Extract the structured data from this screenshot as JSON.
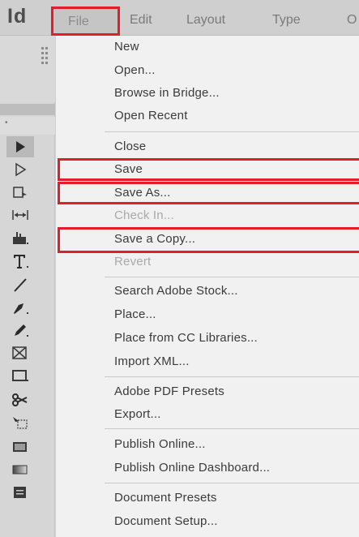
{
  "app": {
    "logo": "Id"
  },
  "menubar": {
    "file": "File",
    "edit": "Edit",
    "layout": "Layout",
    "type": "Type",
    "object_partial": "O"
  },
  "file_menu": {
    "new": "New",
    "open": "Open...",
    "browse_in_bridge": "Browse in Bridge...",
    "open_recent": "Open Recent",
    "close": "Close",
    "save": "Save",
    "save_as": "Save As...",
    "check_in": "Check In...",
    "save_a_copy": "Save a Copy...",
    "revert": "Revert",
    "search_adobe_stock": "Search Adobe Stock...",
    "place": "Place...",
    "place_from_cc_libraries": "Place from CC Libraries...",
    "import_xml": "Import XML...",
    "adobe_pdf_presets": "Adobe PDF Presets",
    "export": "Export...",
    "publish_online": "Publish Online...",
    "publish_online_dashboard": "Publish Online Dashboard...",
    "document_presets": "Document Presets",
    "document_setup": "Document Setup..."
  },
  "tools": [
    "selection-tool",
    "direct-selection-tool",
    "page-tool",
    "gap-tool",
    "content-collector-tool",
    "type-tool",
    "line-tool",
    "pen-tool",
    "pencil-tool",
    "rectangle-frame-tool",
    "rectangle-tool",
    "scissors-tool",
    "free-transform-tool",
    "swatch-tool",
    "gradient-tool",
    "note-tool"
  ],
  "colors": {
    "highlight": "#e31d2b",
    "menu_bg": "#f1f1f1",
    "menubar_bg": "#cfcfcf"
  }
}
